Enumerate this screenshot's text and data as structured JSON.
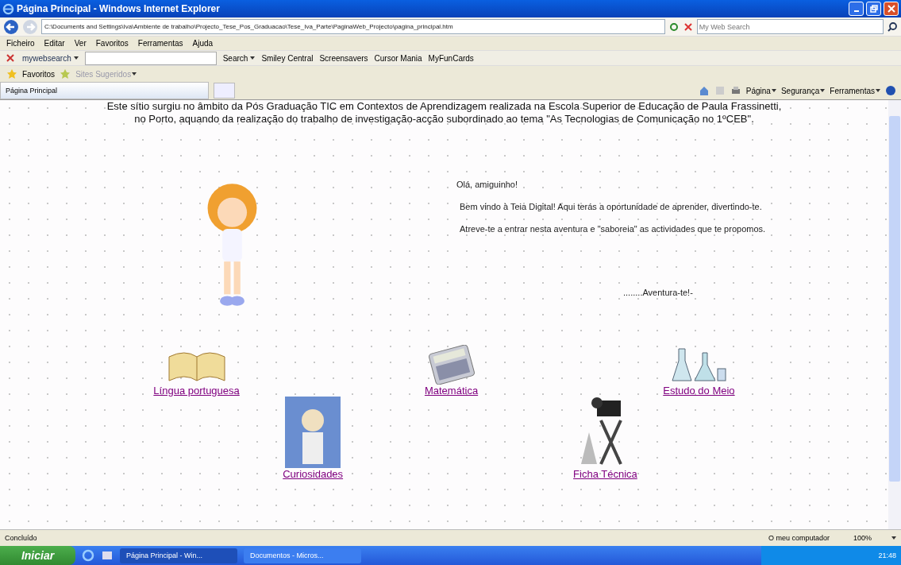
{
  "window": {
    "title": "Página Principal - Windows Internet Explorer"
  },
  "address_bar": {
    "url": "C:\\Documents and Settings\\Iva\\Ambiente de trabalho\\Projecto_Tese_Pos_Graduacao\\Tese_Iva_Parte\\PaginaWeb_Projecto\\pagina_principal.htm",
    "search_placeholder": "My Web Search"
  },
  "menu": [
    "Ficheiro",
    "Editar",
    "Ver",
    "Favoritos",
    "Ferramentas",
    "Ajuda"
  ],
  "toolbar": {
    "brand": "mywebsearch",
    "search": "Search",
    "items": [
      "Smiley Central",
      "Screensavers",
      "Cursor Mania",
      "MyFunCards"
    ]
  },
  "favorites_bar": {
    "label": "Favoritos",
    "suggested": "Sites Sugeridos"
  },
  "tabs": [
    {
      "label": "Página Principal",
      "selected": true
    }
  ],
  "command_bar": [
    "Página",
    "Segurança",
    "Ferramentas"
  ],
  "page": {
    "intro": [
      "Este sítio surgiu no âmbito da Pós Graduação TIC em Contextos de Aprendizagem realizada na Escola Superior de Educação de Paula Frassinetti,",
      "no Porto, aquando da realização do trabalho de investigação-acção subordinado ao tema \"As Tecnologias de Comunicação no 1ºCEB\"."
    ],
    "greeting": "Olá, amiguinho!",
    "welcome": [
      "Bem vindo à Teia Digital! Aqui terás a oportunidade de aprender, divertindo-te.",
      "Atreve-te a entrar nesta aventura e \"saboreia\" as actividades que te propomos."
    ],
    "motto": "........Aventura-te!-",
    "links": [
      {
        "label": "Língua portuguesa",
        "kind": "book"
      },
      {
        "label": "Matemática",
        "kind": "calculator"
      },
      {
        "label": "Estudo do Meio",
        "kind": "lab"
      },
      {
        "label": "Curiosidades",
        "kind": "scientist"
      },
      {
        "label": "Ficha Técnica",
        "kind": "camera"
      }
    ]
  },
  "status_bar": {
    "status": "Concluído",
    "zone": "O meu computador",
    "zoom": "100%"
  },
  "taskbar": {
    "start": "Iniciar",
    "windows": [
      {
        "label": "Página Principal - Win...",
        "selected": true
      },
      {
        "label": "Documentos - Micros...",
        "selected": false
      }
    ],
    "time": "21:48"
  }
}
